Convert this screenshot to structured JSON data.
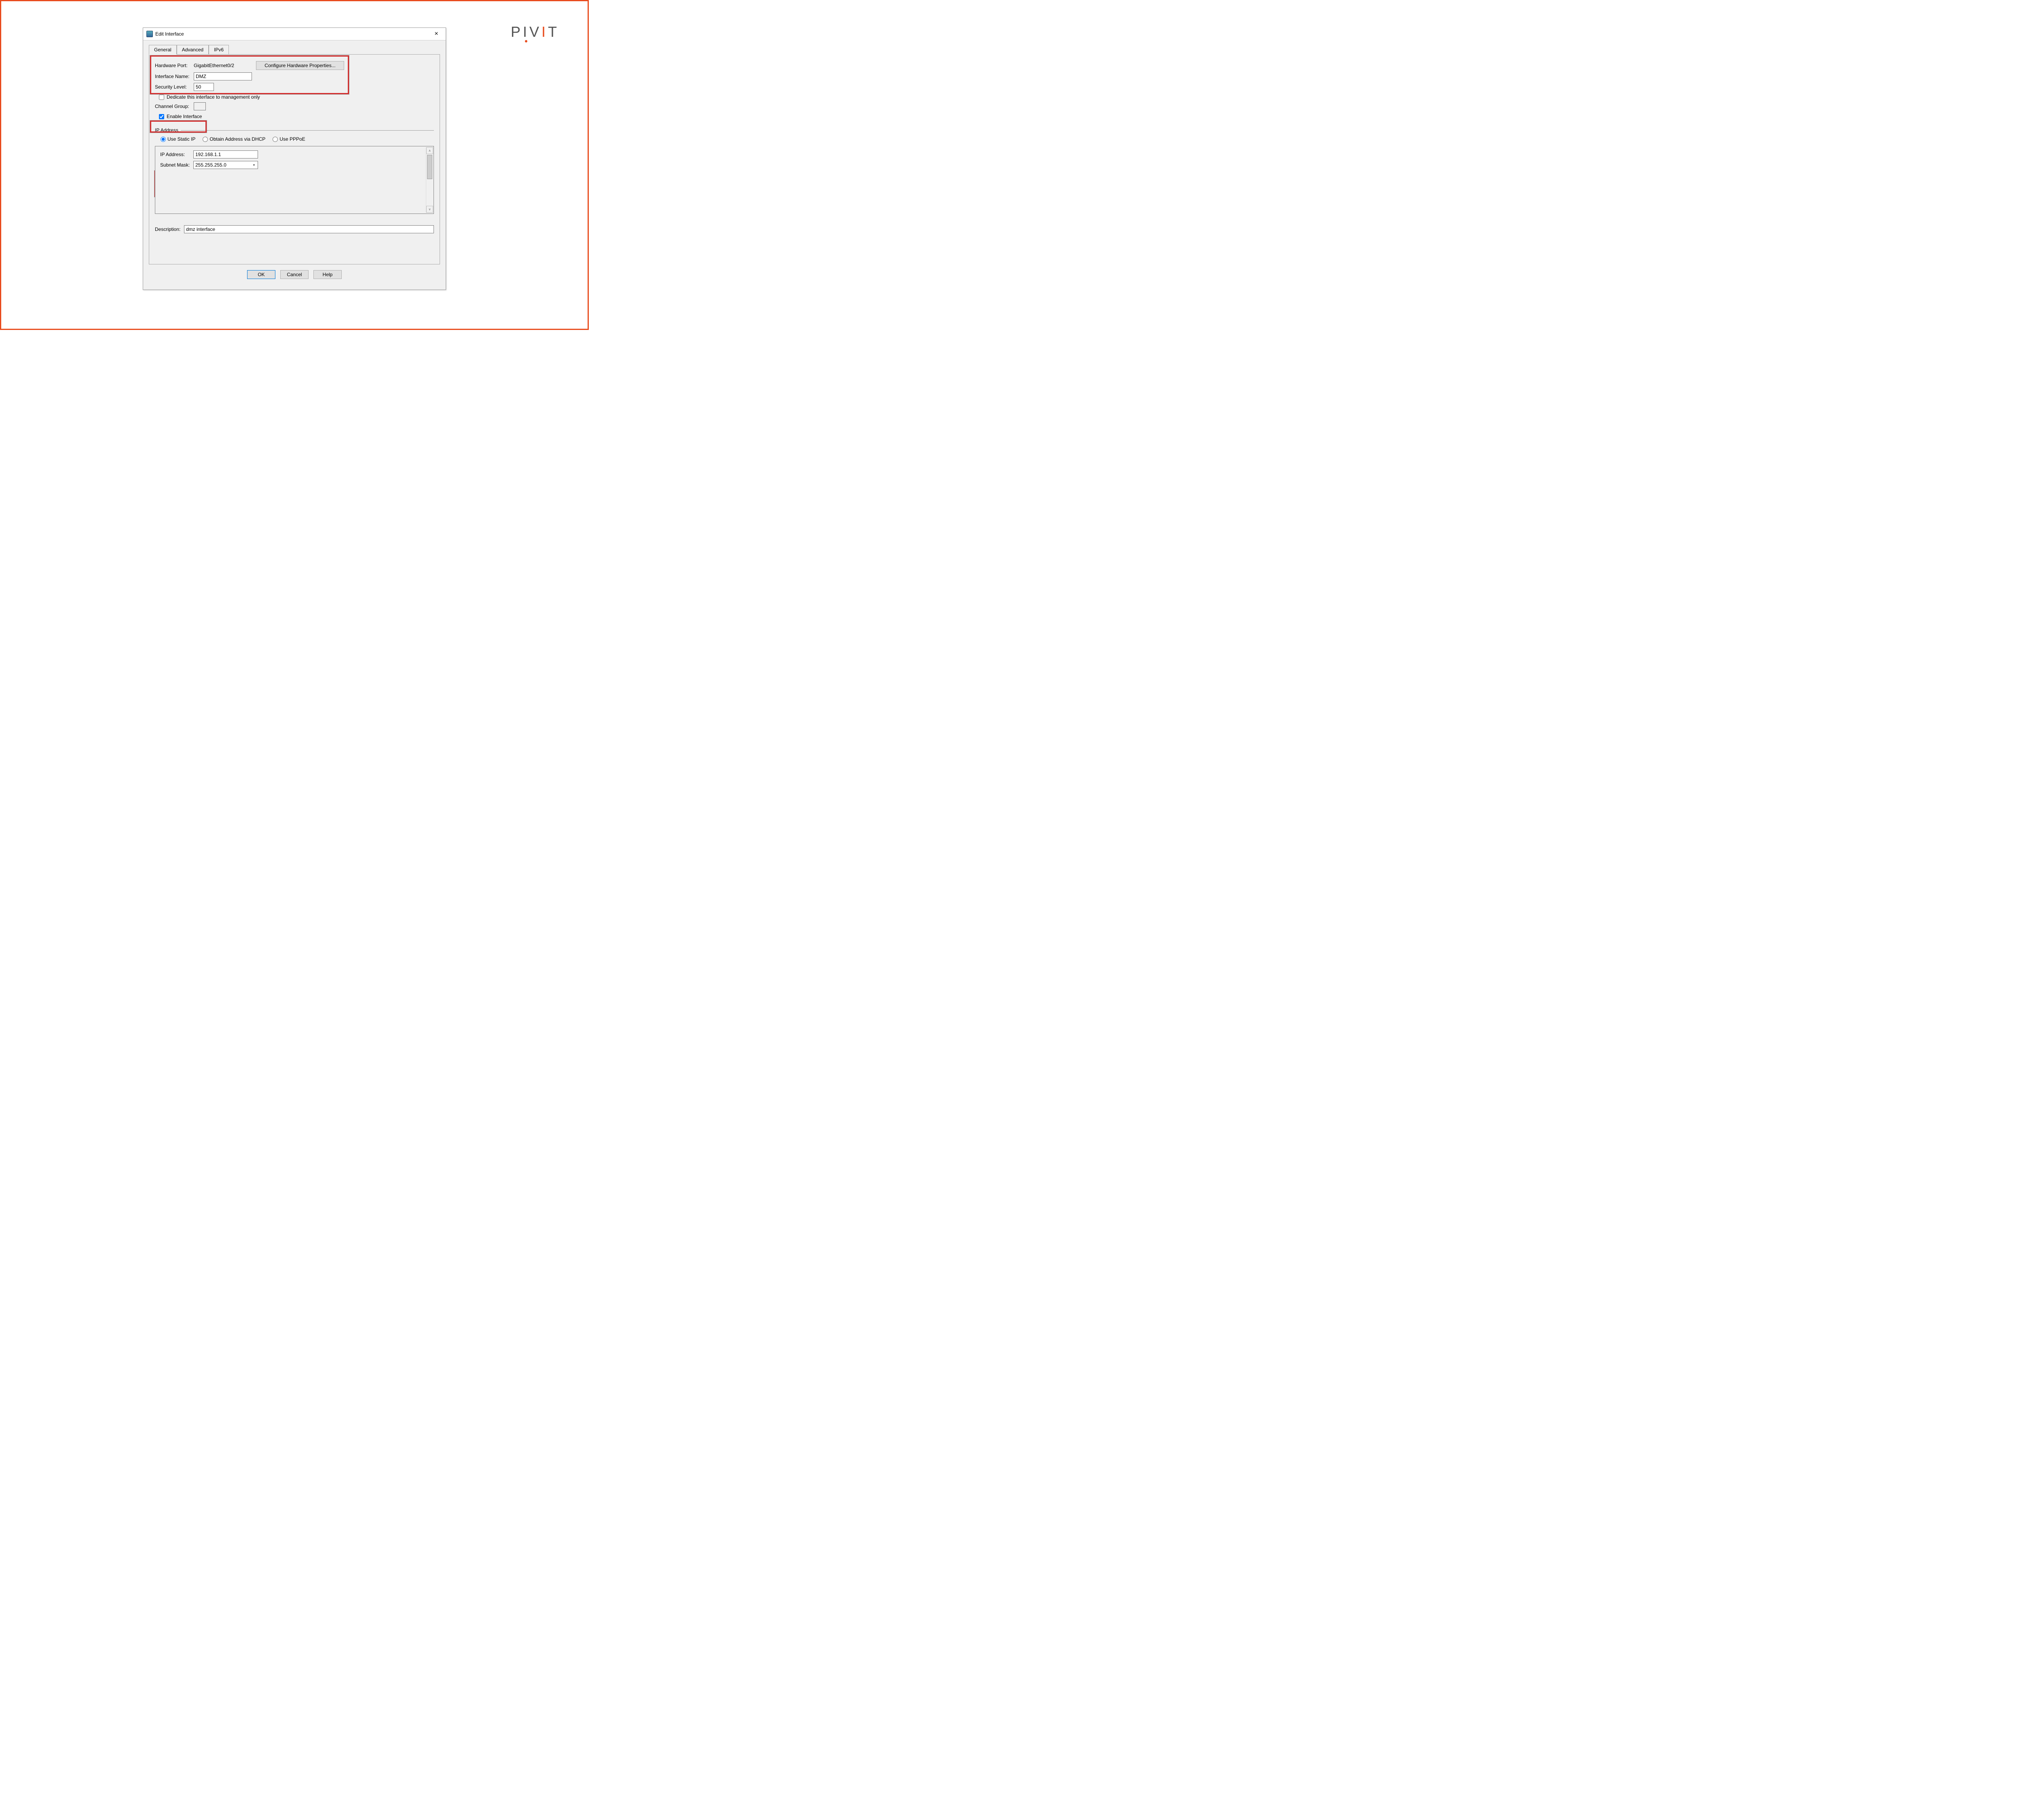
{
  "brand": {
    "text": "PIVIT"
  },
  "window": {
    "title": "Edit Interface",
    "close": "×"
  },
  "tabs": {
    "general": "General",
    "advanced": "Advanced",
    "ipv6": "IPv6"
  },
  "fields": {
    "hardware_port_label": "Hardware Port:",
    "hardware_port_value": "GigabitEthernet0/2",
    "configure_hw_btn": "Configure Hardware Properties...",
    "interface_name_label": "Interface Name:",
    "interface_name_value": "DMZ",
    "security_level_label": "Security Level:",
    "security_level_value": "50",
    "dedicate_mgmt": "Dedicate this interface to management only",
    "channel_group_label": "Channel Group:",
    "channel_group_value": "",
    "enable_interface": "Enable Interface"
  },
  "ip": {
    "group_title": "IP Address",
    "static": "Use Static IP",
    "dhcp": "Obtain Address via DHCP",
    "pppoe": "Use PPPoE",
    "ip_label": "IP Address:",
    "ip_value": "192.168.1.1",
    "mask_label": "Subnet Mask:",
    "mask_value": "255.255.255.0"
  },
  "description": {
    "label": "Description:",
    "value": "dmz interface"
  },
  "buttons": {
    "ok": "OK",
    "cancel": "Cancel",
    "help": "Help"
  }
}
